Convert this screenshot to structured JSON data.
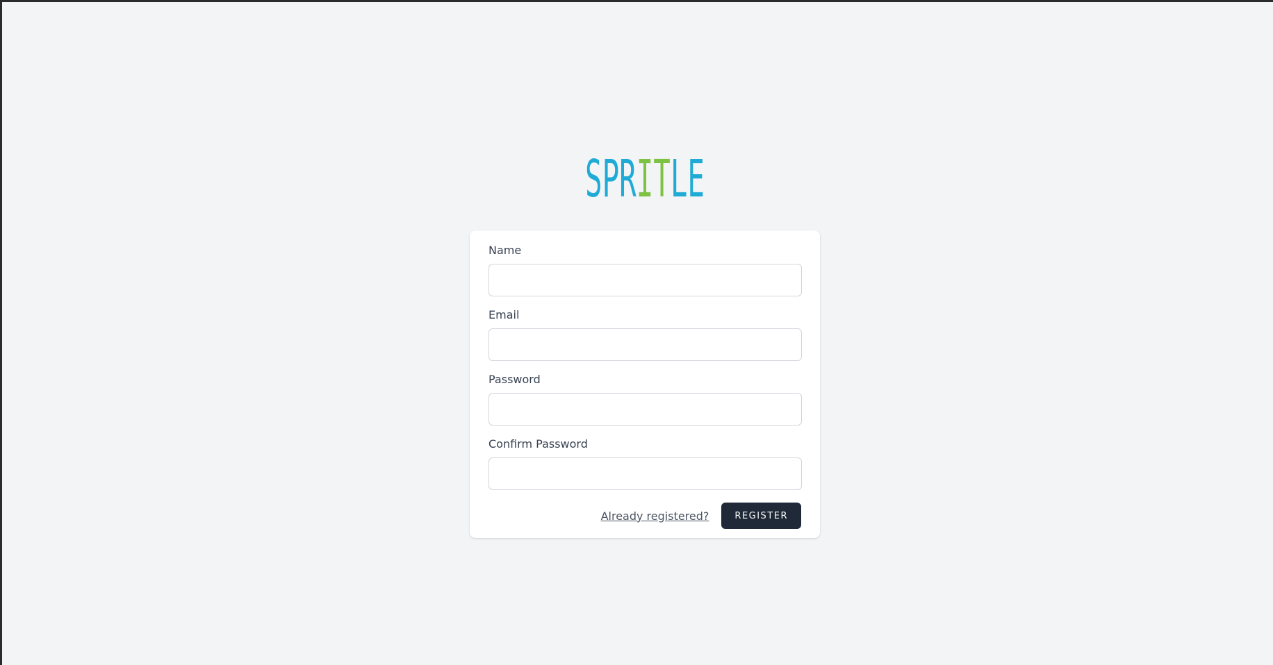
{
  "brand": {
    "logo_text": "SPRITLE",
    "logo_parts": [
      "SPR",
      "IT",
      "LE"
    ],
    "colors": {
      "primary": "#1fabd5",
      "accent": "#7dc242"
    }
  },
  "form": {
    "fields": [
      {
        "label": "Name",
        "value": "",
        "placeholder": ""
      },
      {
        "label": "Email",
        "value": "",
        "placeholder": ""
      },
      {
        "label": "Password",
        "value": "",
        "placeholder": ""
      },
      {
        "label": "Confirm Password",
        "value": "",
        "placeholder": ""
      }
    ],
    "login_link": "Already registered?",
    "submit_label": "REGISTER"
  },
  "colors": {
    "page_background": "#f3f4f6",
    "card_background": "#ffffff",
    "button_background": "#1f2937"
  }
}
